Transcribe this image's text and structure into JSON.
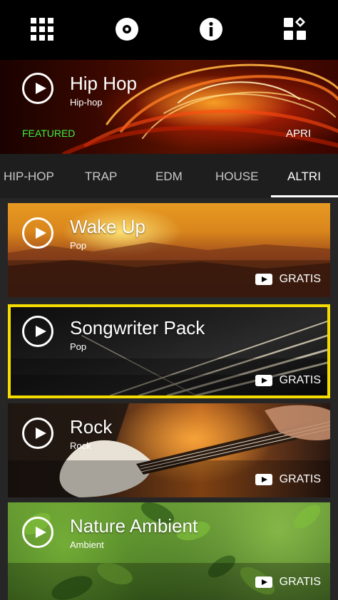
{
  "topbar": {
    "icons": [
      "grid-icon",
      "disc-icon",
      "info-icon",
      "apps-icon"
    ]
  },
  "featured": {
    "title": "Hip Hop",
    "subtitle": "Hip-hop",
    "badge": "FEATURED",
    "open_label": "APRI",
    "badge_color": "#3ef03e"
  },
  "tabs": [
    {
      "label": "HIP-HOP",
      "active": false
    },
    {
      "label": "TRAP",
      "active": false
    },
    {
      "label": "EDM",
      "active": false
    },
    {
      "label": "HOUSE",
      "active": false
    },
    {
      "label": "ALTRI",
      "active": true
    }
  ],
  "cards": [
    {
      "title": "Wake Up",
      "subtitle": "Pop",
      "price": "GRATIS"
    },
    {
      "title": "Songwriter Pack",
      "subtitle": "Pop",
      "price": "GRATIS",
      "selected": true
    },
    {
      "title": "Rock",
      "subtitle": "Rock",
      "price": "GRATIS"
    },
    {
      "title": "Nature Ambient",
      "subtitle": "Ambient",
      "price": "GRATIS"
    }
  ],
  "colors": {
    "highlight": "#f5dc00",
    "background": "#262626"
  }
}
